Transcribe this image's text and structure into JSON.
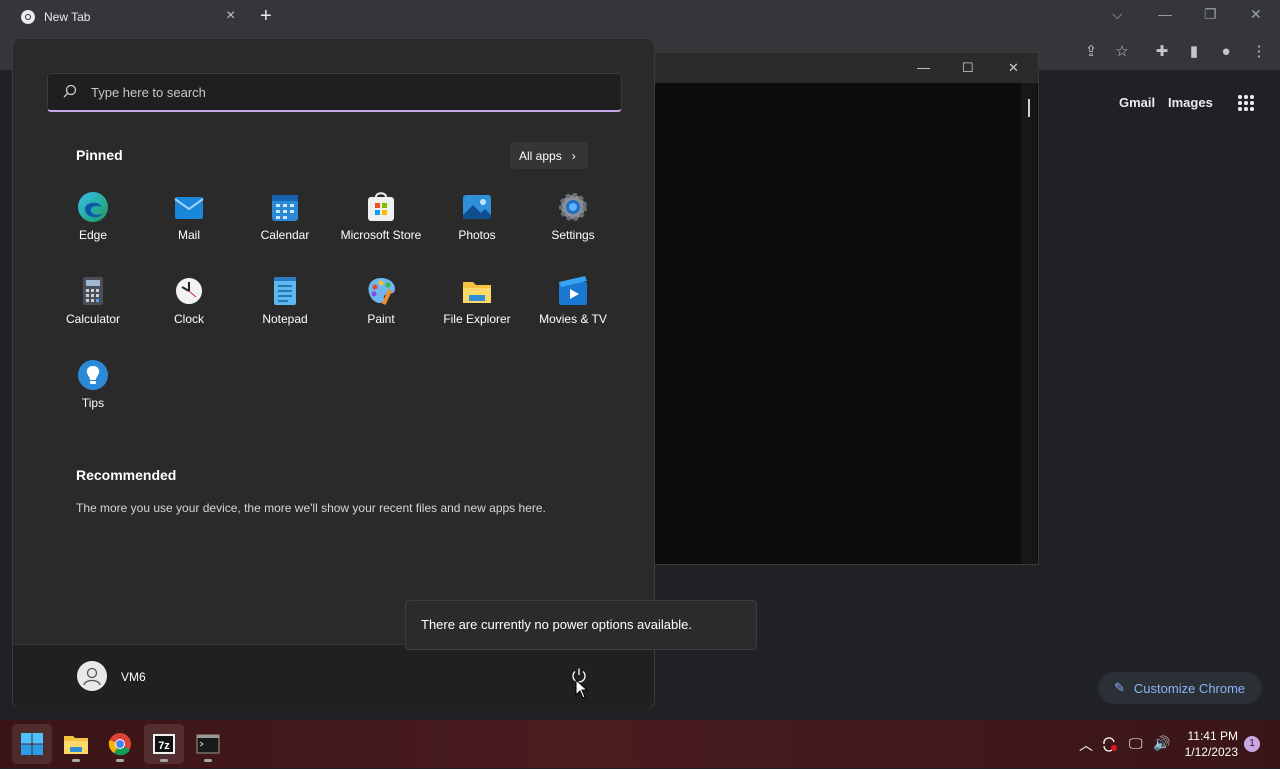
{
  "browser": {
    "tab_title": "New Tab",
    "links": {
      "gmail": "Gmail",
      "images": "Images"
    },
    "customize_label": "Customize Chrome"
  },
  "start_menu": {
    "search_placeholder": "Type here to search",
    "pinned_title": "Pinned",
    "all_apps_label": "All apps",
    "pinned_apps": [
      {
        "label": "Edge",
        "icon": "edge-icon"
      },
      {
        "label": "Mail",
        "icon": "mail-icon"
      },
      {
        "label": "Calendar",
        "icon": "calendar-icon"
      },
      {
        "label": "Microsoft Store",
        "icon": "store-icon"
      },
      {
        "label": "Photos",
        "icon": "photos-icon"
      },
      {
        "label": "Settings",
        "icon": "gear-icon"
      },
      {
        "label": "Calculator",
        "icon": "calculator-icon"
      },
      {
        "label": "Clock",
        "icon": "clock-icon"
      },
      {
        "label": "Notepad",
        "icon": "notepad-icon"
      },
      {
        "label": "Paint",
        "icon": "paint-icon"
      },
      {
        "label": "File Explorer",
        "icon": "folder-icon"
      },
      {
        "label": "Movies & TV",
        "icon": "movies-icon"
      },
      {
        "label": "Tips",
        "icon": "tips-icon"
      }
    ],
    "recommended_title": "Recommended",
    "recommended_text": "The more you use your device, the more we'll show your recent files and new apps here.",
    "user_name": "VM6",
    "power_tooltip": "There are currently no power options available."
  },
  "taskbar": {
    "time": "11:41 PM",
    "date": "1/12/2023",
    "notification_count": "1"
  },
  "colors": {
    "accent": "#c8a4e8",
    "link_blue": "#8ab4f8",
    "taskbar": "#4a1d1f"
  }
}
